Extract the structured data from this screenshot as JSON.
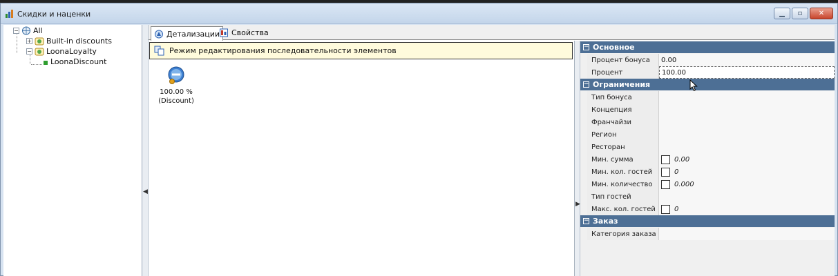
{
  "window": {
    "title": "Скидки и наценки"
  },
  "tree": {
    "root": {
      "label": "All",
      "expander": "−"
    },
    "children": [
      {
        "label": "Built-in discounts",
        "expander": "+"
      },
      {
        "label": "LoonaLoyalty",
        "expander": "−"
      }
    ],
    "grandchild": {
      "label": "LoonaDiscount"
    }
  },
  "tabs": [
    {
      "label": "Детализации",
      "icon": "details-icon"
    },
    {
      "label": "Свойства",
      "icon": "properties-icon"
    }
  ],
  "detail": {
    "banner": "Режим редактирования последовательности элементов",
    "element": {
      "value": "100.00 %",
      "caption": "(Discount)"
    }
  },
  "property_grid": {
    "categories": [
      {
        "name": "Основное",
        "rows": [
          {
            "name": "Процент бонуса",
            "value": "0.00"
          },
          {
            "name": "Процент",
            "value": "100.00"
          }
        ]
      },
      {
        "name": "Ограничения",
        "rows": [
          {
            "name": "Тип бонуса",
            "value": ""
          },
          {
            "name": "Концепция",
            "value": ""
          },
          {
            "name": "Франчайзи",
            "value": ""
          },
          {
            "name": "Регион",
            "value": ""
          },
          {
            "name": "Ресторан",
            "value": ""
          },
          {
            "name": "Мин. сумма",
            "value": "0.00",
            "checked": false
          },
          {
            "name": "Мин. кол. гостей",
            "value": "0",
            "checked": false
          },
          {
            "name": "Мин. количество",
            "value": "0.000",
            "checked": false
          },
          {
            "name": "Тип гостей",
            "value": ""
          },
          {
            "name": "Макс. кол. гостей",
            "value": "0",
            "checked": false
          }
        ]
      },
      {
        "name": "Заказ",
        "rows": [
          {
            "name": "Категория заказа",
            "value": ""
          }
        ]
      }
    ]
  },
  "colors": {
    "category_bar": "#4d6f95",
    "banner_bg": "#fffbdc",
    "titlebar": "#c3d5ea"
  }
}
